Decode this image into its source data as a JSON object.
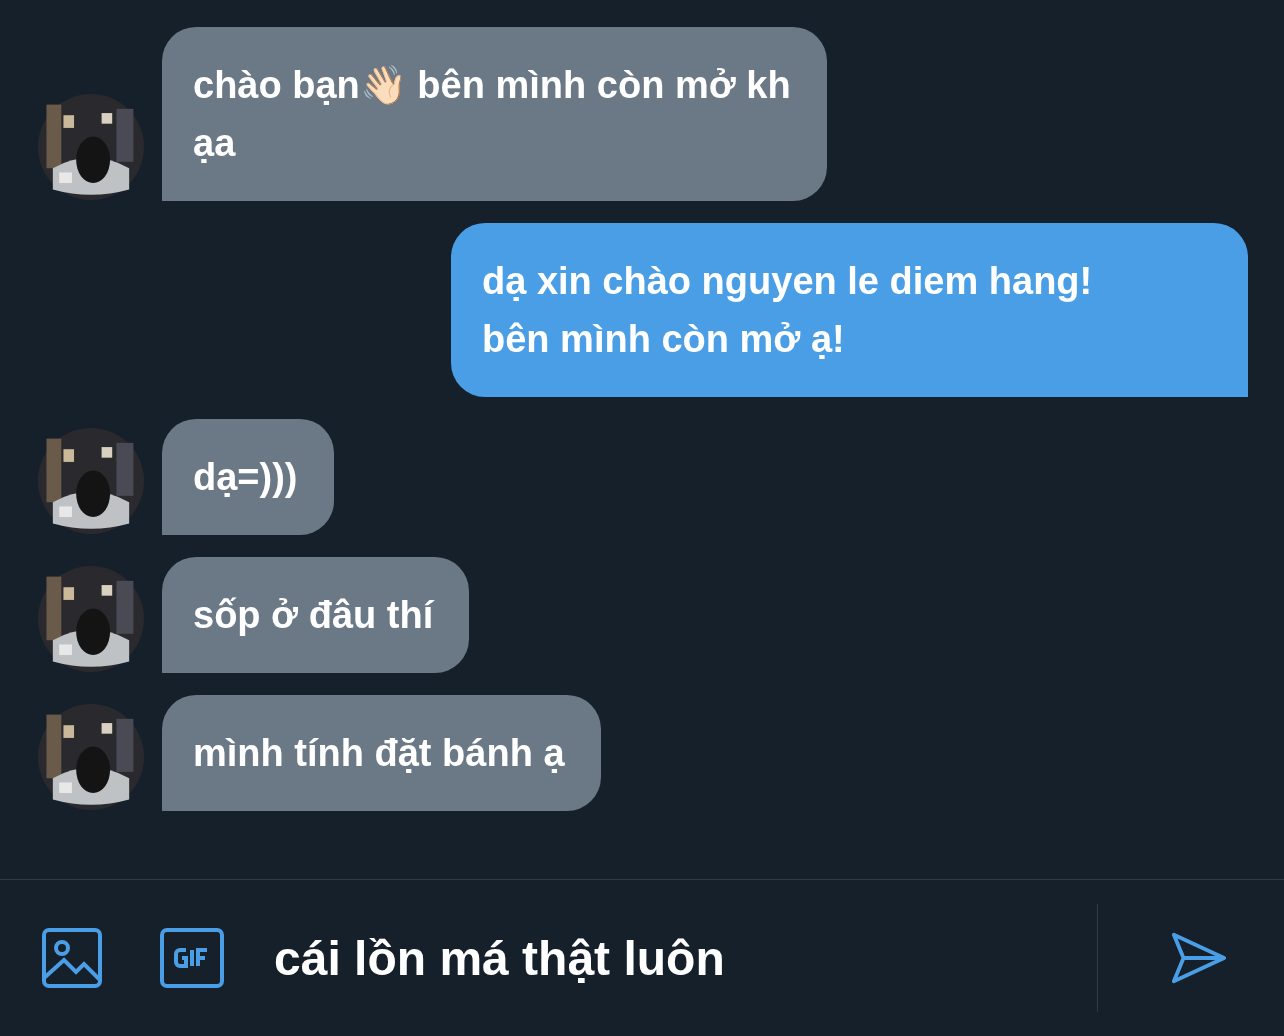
{
  "messages": [
    {
      "kind": "incoming",
      "text": "chào bạn👋🏻  bên mình còn mở kh\nạa"
    },
    {
      "kind": "outgoing",
      "text": "dạ xin chào nguyen le diem hang!\nbên mình còn mở ạ!"
    },
    {
      "kind": "incoming",
      "text": "dạ=)))"
    },
    {
      "kind": "incoming",
      "text": "sốp ở đâu thí"
    },
    {
      "kind": "incoming",
      "text": "mình tính đặt bánh ạ"
    }
  ],
  "composer": {
    "value": "cái lồn má thật luôn"
  }
}
